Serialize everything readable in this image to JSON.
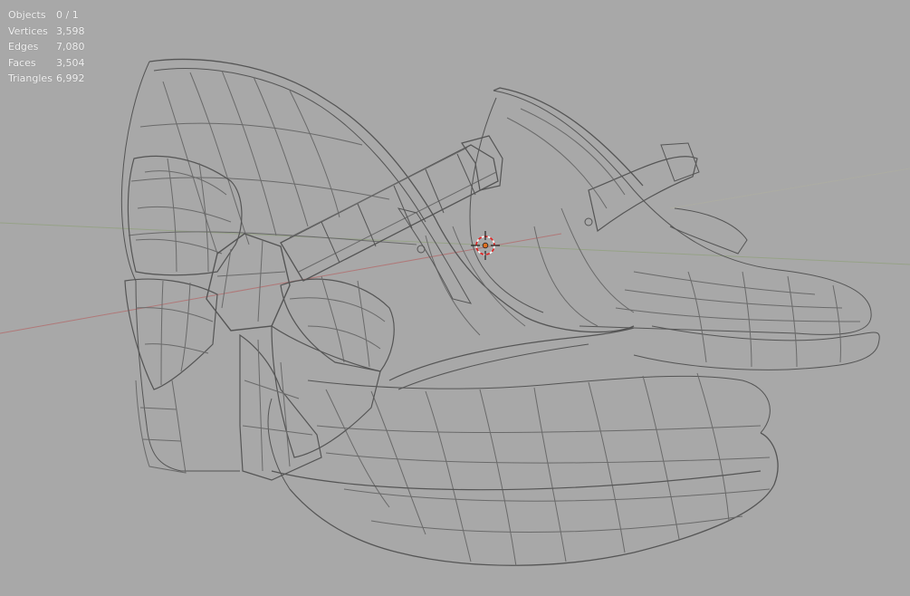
{
  "viewport": {
    "background_color": "#a8a8a8",
    "wire_color": "#545454",
    "wire_light_color": "#6a6a6a",
    "x_axis_color": "#b07878",
    "y_axis_color": "#8fa07a",
    "cursor_color": "#e07020"
  },
  "stats": [
    {
      "label": "Objects",
      "value": "0 / 1"
    },
    {
      "label": "Vertices",
      "value": "3,598"
    },
    {
      "label": "Edges",
      "value": "7,080"
    },
    {
      "label": "Faces",
      "value": "3,504"
    },
    {
      "label": "Triangles",
      "value": "6,992"
    }
  ],
  "scene": {
    "object": "wireframe-shoe-pair-mesh",
    "cursor_icon": "3d-cursor-icon",
    "origin_icon": "object-origin-icon"
  }
}
